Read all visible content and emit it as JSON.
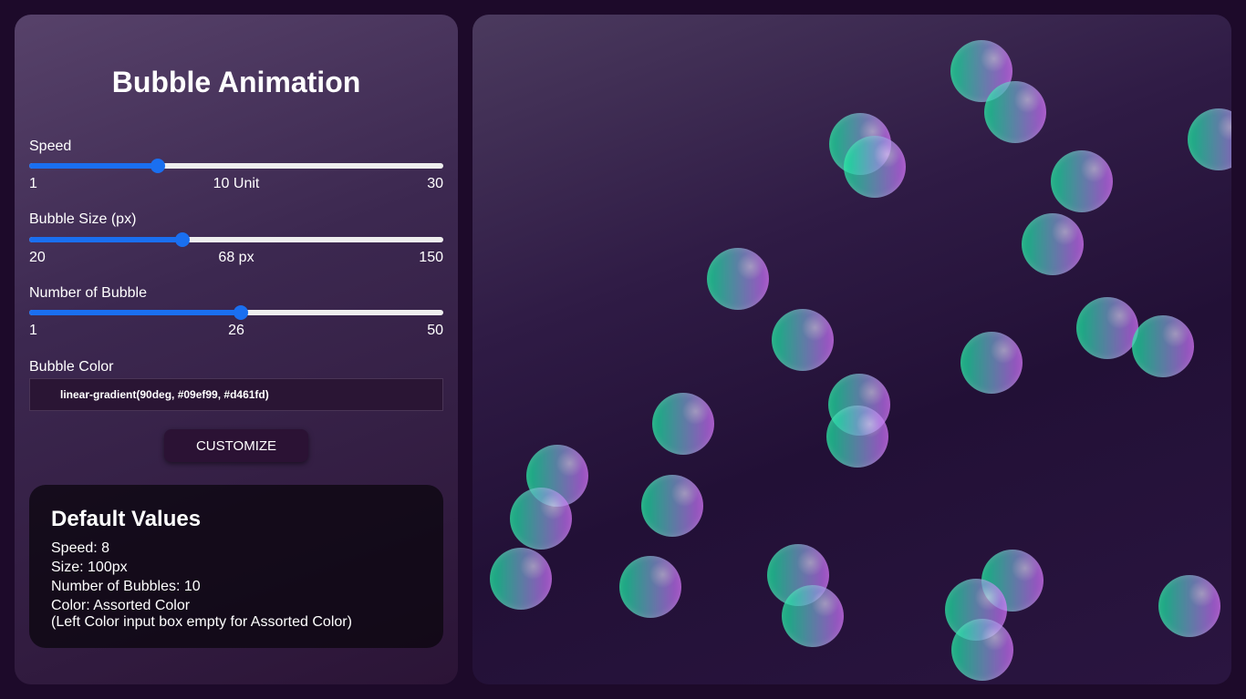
{
  "panel": {
    "title": "Bubble Animation",
    "speed": {
      "label": "Speed",
      "min": "1",
      "current": "10 Unit",
      "max": "30",
      "value": 10,
      "min_value": 1,
      "max_value": 30
    },
    "size": {
      "label": "Bubble Size (px)",
      "min": "20",
      "current": "68 px",
      "max": "150",
      "value": 68,
      "min_value": 20,
      "max_value": 150
    },
    "count": {
      "label": "Number of Bubble",
      "min": "1",
      "current": "26",
      "max": "50",
      "value": 26,
      "min_value": 1,
      "max_value": 50
    },
    "color": {
      "label": "Bubble Color",
      "value": "linear-gradient(90deg, #09ef99, #d461fd)"
    },
    "customize_label": "CUSTOMIZE",
    "defaults": {
      "title": "Default Values",
      "lines": [
        "Speed: 8",
        "Size: 100px",
        "Number of Bubbles: 10",
        "Color: Assorted Color",
        "(Left Color input box empty for Assorted Color)"
      ]
    }
  },
  "colors": {
    "accent": "#1a6ff0",
    "bubble_start": "#09ef99",
    "bubble_end": "#d461fd"
  }
}
